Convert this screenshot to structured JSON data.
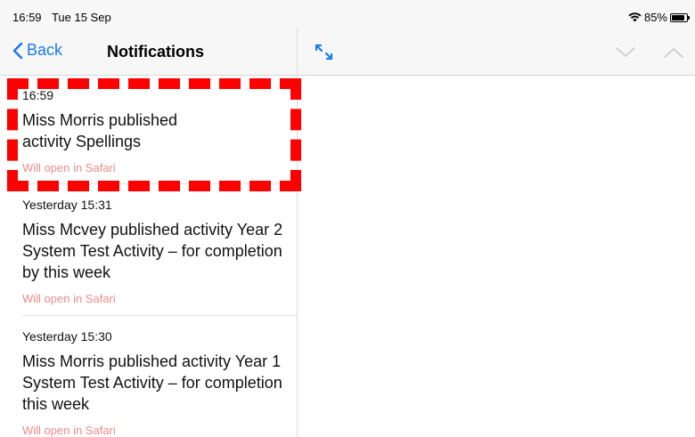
{
  "status": {
    "time": "16:59",
    "date": "Tue 15 Sep",
    "battery": "85%",
    "battery_level": 0.85
  },
  "left_nav": {
    "back_label": "Back",
    "title": "Notifications"
  },
  "notifications": [
    {
      "time": "16:59",
      "message": "Miss Morris published activity Spellings",
      "subtitle": "Will open in Safari"
    },
    {
      "time": "Yesterday 15:31",
      "message": "Miss Mcvey published activity Year 2 System Test Activity – for completion by this week",
      "subtitle": "Will open in Safari"
    },
    {
      "time": "Yesterday 15:30",
      "message": "Miss Morris published activity Year 1 System Test Activity – for completion this week",
      "subtitle": "Will open in Safari"
    }
  ],
  "colors": {
    "accent": "#1a7aef",
    "subtitle": "#f08a8a",
    "highlight": "#ff0000"
  },
  "icons": [
    "wifi-icon",
    "battery-icon",
    "back-chevron-icon",
    "expand-icon",
    "chevron-down-icon",
    "chevron-up-icon"
  ]
}
